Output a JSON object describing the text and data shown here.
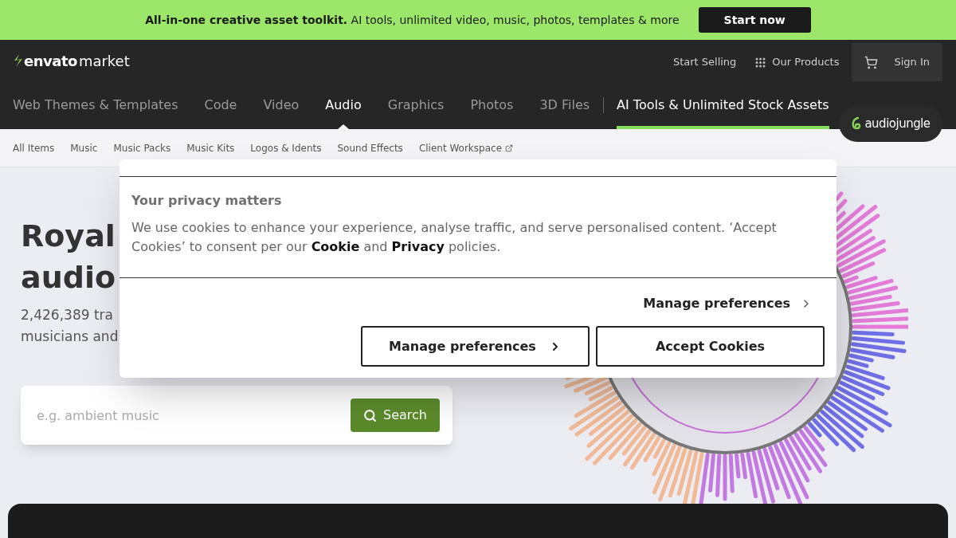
{
  "promo_banner": {
    "text": "**All-in-one creative asset toolkit.** AI tools, unlimited video, music, photos, templates & more",
    "button": "Start now"
  },
  "header": {
    "logo": {
      "brand": "envato",
      "product": "market"
    },
    "links": [
      {
        "label": "Start Selling",
        "kind": "text"
      },
      {
        "label": "Our Products",
        "kind": "grid"
      },
      {
        "label": "Sign In",
        "kind": "account"
      }
    ]
  },
  "category_nav": [
    {
      "label": "Web Themes & Templates",
      "kind": "category",
      "selected": false
    },
    {
      "label": "Code",
      "kind": "category",
      "selected": false
    },
    {
      "label": "Video",
      "kind": "category",
      "selected": false
    },
    {
      "label": "Audio",
      "kind": "category",
      "selected": true
    },
    {
      "label": "Graphics",
      "kind": "category",
      "selected": false
    },
    {
      "label": "Photos",
      "kind": "category",
      "selected": false
    },
    {
      "label": "3D Files",
      "kind": "category",
      "selected": false
    },
    {
      "label": "AI Tools & Unlimited Stock Assets",
      "kind": "promo",
      "selected": false
    }
  ],
  "sub_nav": [
    {
      "label": "All Items",
      "external": false
    },
    {
      "label": "Music",
      "external": false
    },
    {
      "label": "Music Packs",
      "external": false
    },
    {
      "label": "Music Kits",
      "external": false
    },
    {
      "label": "Logos & Idents",
      "external": false
    },
    {
      "label": "Sound Effects",
      "external": false
    },
    {
      "label": "Client Workspace",
      "external": true
    }
  ],
  "site_badge": {
    "label": "audiojungle"
  },
  "hero": {
    "title_lines": [
      "Royal",
      "audio"
    ],
    "subtitle_lines": [
      "2,426,389 tra",
      "musicians and"
    ],
    "search": {
      "placeholder": "e.g. ambient music",
      "button": "Search"
    }
  },
  "cookie_dialog": {
    "title": "Your privacy matters",
    "body": "We use cookies to enhance your experience, analyse traffic, and serve personalised content. ‘Accept Cookies’ to consent per our **Cookie** and **Privacy** policies.",
    "manage_link": "Manage preferences",
    "buttons": [
      {
        "label": "Manage preferences",
        "kind": "chevron"
      },
      {
        "label": "Accept Cookies",
        "kind": "plain"
      }
    ]
  }
}
